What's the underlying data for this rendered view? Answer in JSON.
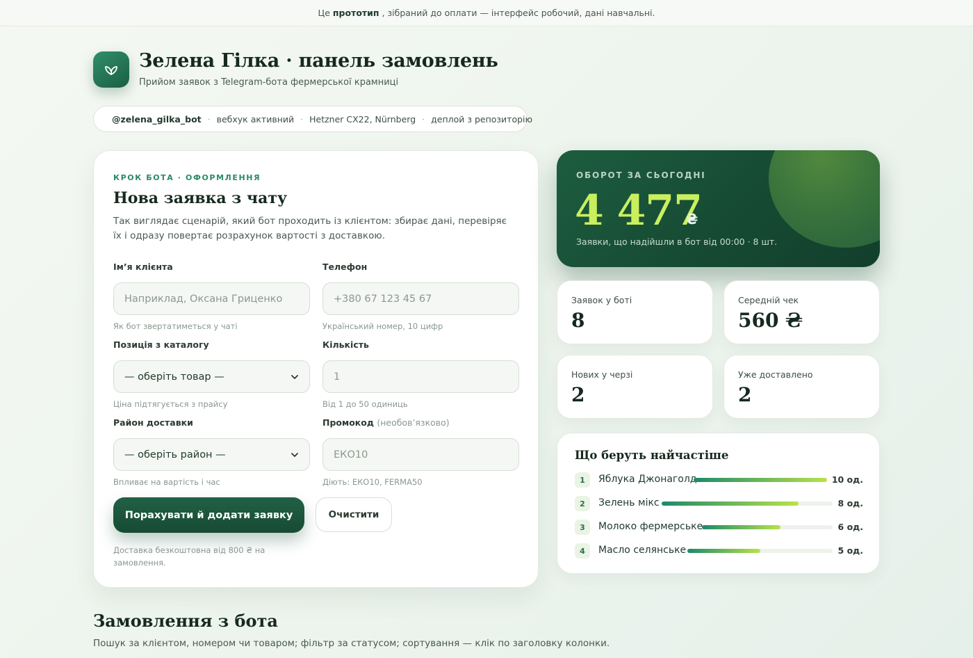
{
  "banner": {
    "prefix": "Це",
    "bold": "прототип",
    "suffix": ", зібраний до оплати — інтерфейс робочий, дані навчальні."
  },
  "header": {
    "logo_icon": "leaf-icon",
    "title": "Зелена Гілка · панель замовлень",
    "subtitle": "Прийом заявок з Telegram-бота фермерської крамниці"
  },
  "status": {
    "bot": "@zelena_gilka_bot",
    "separator": "·",
    "webhook": "вебхук активний",
    "server": "Hetzner CX22, Nürnberg",
    "deploy": "деплой з репозиторію",
    "dot_color": "#27a06d"
  },
  "form": {
    "eyebrow": "КРОК БОТА · ОФОРМЛЕННЯ",
    "title": "Нова заявка з чату",
    "description": "Так виглядає сценарій, який бот проходить із клієнтом: збирає дані, перевіряє їх і одразу повертає розрахунок вартості з доставкою.",
    "fields": {
      "name": {
        "label": "Ім’я клієнта",
        "placeholder": "Наприклад, Оксана Гриценко",
        "hint": "Як бот звертатиметься у чаті"
      },
      "phone": {
        "label": "Телефон",
        "placeholder": "+380 67 123 45 67",
        "hint": "Український номер, 10 цифр"
      },
      "product": {
        "label": "Позиція з каталогу",
        "value": "— оберіть товар —",
        "hint": "Ціна підтягується з прайсу"
      },
      "quantity": {
        "label": "Кількість",
        "placeholder": "1",
        "hint": "Від 1 до 50 одиниць"
      },
      "district": {
        "label": "Район доставки",
        "value": "— оберіть район —",
        "hint": "Впливає на вартість і час"
      },
      "promo": {
        "label": "Промокод",
        "label_optional": "(необов’язково)",
        "placeholder": "ЕКО10",
        "hint": "Діють: ЕКО10, FERMA50"
      }
    },
    "submit_label": "Порахувати й додати заявку",
    "clear_label": "Очистити",
    "note": "Доставка безкоштовна від 800 ₴ на замовлення."
  },
  "turnover": {
    "label": "ОБОРОТ ЗА СЬОГОДНІ",
    "value": "4 477",
    "currency": "₴",
    "subtitle": "Заявки, що надійшли в бот від 00:00 · 8 шт."
  },
  "stats": [
    {
      "label": "Заявок у боті",
      "value": "8"
    },
    {
      "label": "Середній чек",
      "value": "560 ₴"
    },
    {
      "label": "Нових у черзі",
      "value": "2"
    },
    {
      "label": "Уже доставлено",
      "value": "2"
    }
  ],
  "popular": {
    "title": "Що беруть найчастіше",
    "items": [
      {
        "rank": "1",
        "name": "Яблука Джонаголд",
        "qty": "10 од.",
        "share": 1.0
      },
      {
        "rank": "2",
        "name": "Зелень мікс",
        "qty": "8 од.",
        "share": 0.8
      },
      {
        "rank": "3",
        "name": "Молоко фермерське",
        "qty": "6 од.",
        "share": 0.6
      },
      {
        "rank": "4",
        "name": "Масло селянське",
        "qty": "5 од.",
        "share": 0.5
      }
    ]
  },
  "orders": {
    "title": "Замовлення з бота",
    "subtitle": "Пошук за клієнтом, номером чи товаром; фільтр за статусом; сортування — клік по заголовку колонки."
  },
  "colors": {
    "accent": "#1f6b4a",
    "highlight": "#c9ef5f",
    "bar_start": "#1d8a6a",
    "bar_end": "#b9e24a"
  }
}
